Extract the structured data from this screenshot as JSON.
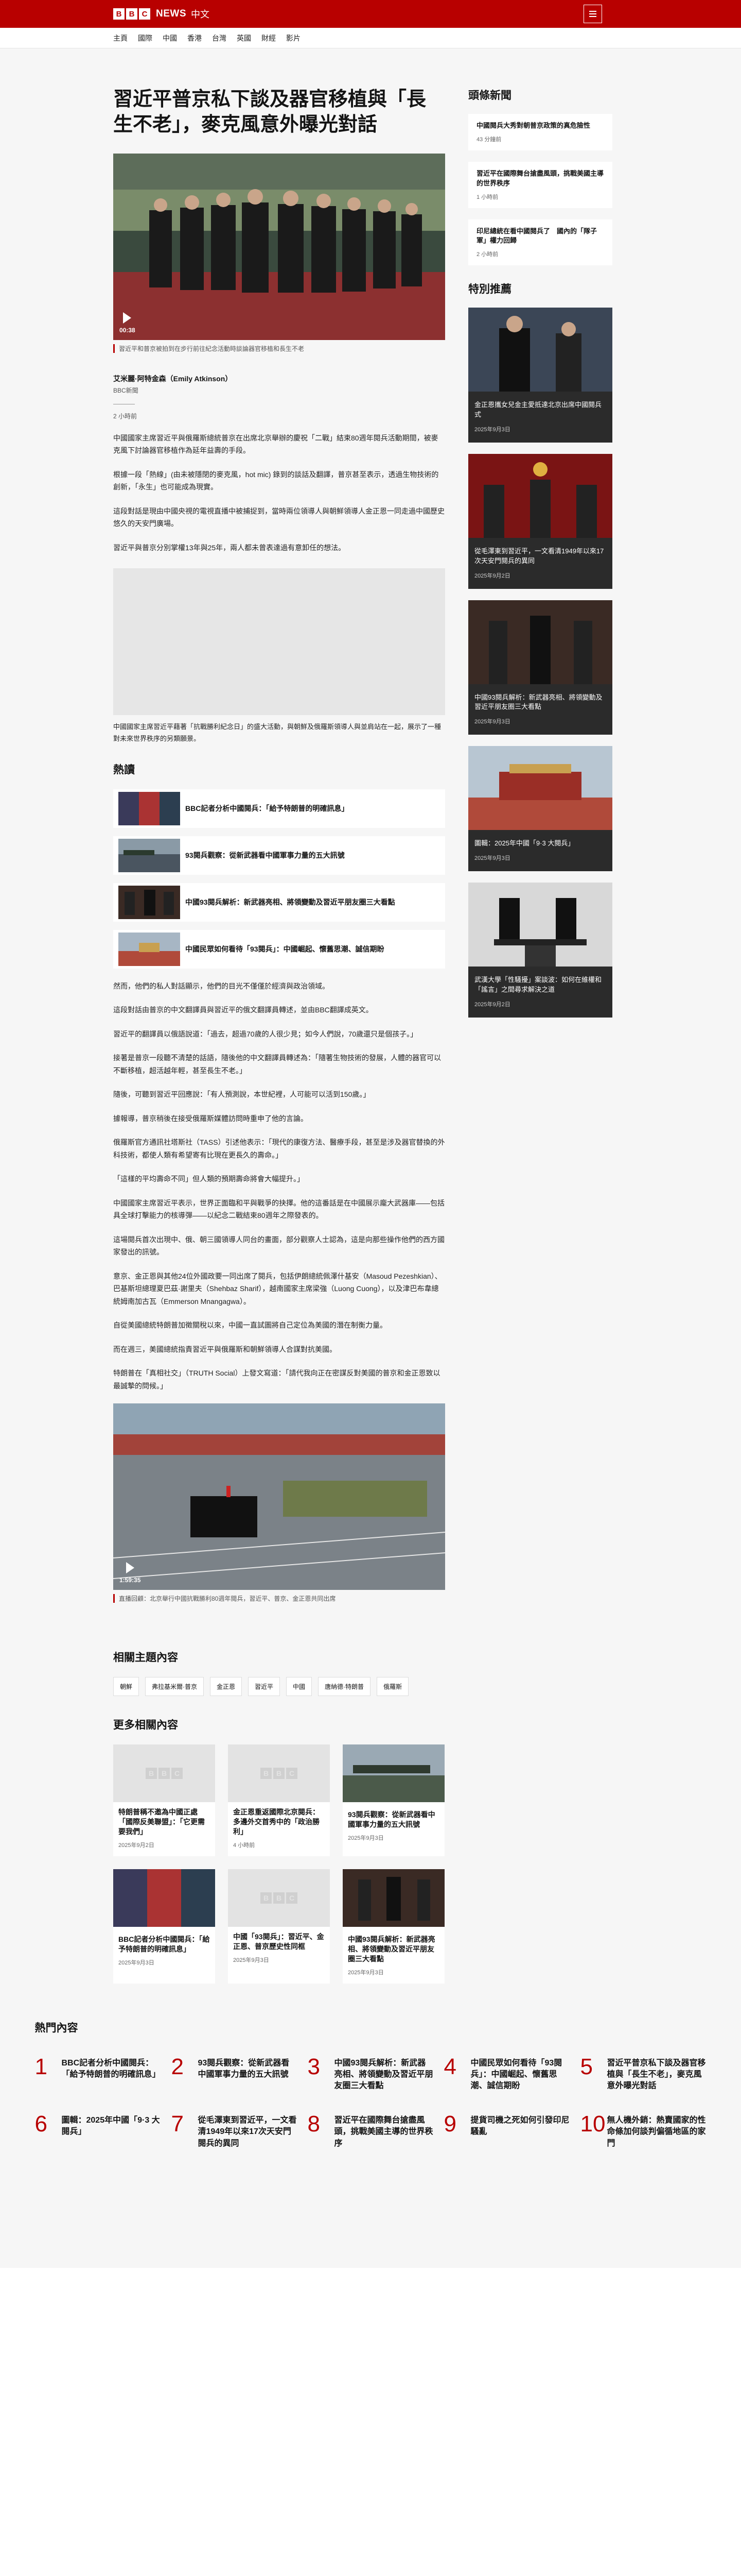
{
  "header": {
    "logo_letters": [
      "B",
      "B",
      "C"
    ],
    "logo_news": "NEWS",
    "logo_lang": "中文",
    "menu_icon": "hamburger-icon"
  },
  "nav": [
    "主頁",
    "國際",
    "中國",
    "香港",
    "台灣",
    "英國",
    "財經",
    "影片"
  ],
  "article": {
    "headline": "習近平普京私下談及器官移植與「長生不老」，麥克風意外曝光對話",
    "hero_video_duration": "00:38",
    "hero_caption": "習近平和普京被拍到在步行前往紀念活動時談論器官移植和長生不老",
    "author": "艾米麗·阿特金森（Emily Atkinson）",
    "org": "BBC新聞",
    "time": "2 小時前",
    "paras_a": [
      "中國國家主席習近平與俄羅斯總統普京在出席北京舉辦的慶祝「二戰」結束80週年閱兵活動期間，被麥克風下討論器官移植作為延年益壽的手段。",
      "根據一段「熱線」(由未被隱閉的麥克風，hot mic) 錄到的談話及翻譯，普京甚至表示，透過生物技術的創新，「永生」也可能成為現實。",
      "這段對話是現由中國央視的電視直播中被捕捉到，當時兩位領導人與朝鮮領導人金正恩一同走過中國歷史悠久的天安門廣場。",
      "習近平與普京分別掌權13年與25年，兩人都未曾表達過有意卸任的想法。"
    ],
    "image2_caption": "中國國家主席習近平藉著「抗戰勝利紀念日」的盛大活動，與朝鮮及俄羅斯領導人與並肩站在一起，展示了一種對未來世界秩序的另類願景。",
    "hot_title": "熱讀",
    "hot_items": [
      "BBC記者分析中國閱兵：「給予特朗普的明確訊息」",
      "93閱兵觀察：從新武器看中國軍事力量的五大訊號",
      "中國93閱兵解析：新武器亮相、將領變動及習近平朋友圈三大看點",
      "中國民眾如何看待「93閱兵」：中國崛起、懷舊思潮、誠信期盼"
    ],
    "paras_b": [
      "然而，他們的私人對話顯示，他們的目光不僅僅於經濟與政治領域。",
      "這段對話由普京的中文翻譯員與習近平的俄文翻譯員轉述，並由BBC翻譯成英文。",
      "習近平的翻譯員以俄語說道：「過去，超過70歲的人很少見；如今人們說，70歲還只是個孩子。」",
      "接著是普京一段聽不清楚的話語，隨後他的中文翻譯員轉述為：「隨著生物技術的發展，人體的器官可以不斷移植，超活越年輕，甚至長生不老。」",
      "隨後，可聽到習近平回應說：「有人預測說，本世紀裡，人可能可以活到150歲。」",
      "據報導，普京稍後在接受俄羅斯媒體訪問時重申了他的言論。",
      "俄羅斯官方通訊社塔斯社（TASS）引述他表示：「現代的康復方法、醫療手段，甚至是涉及器官替換的外科技術，都使人類有希望寄有比現在更長久的壽命。」",
      "「這樣的平均壽命不同」但人類的預期壽命將會大幅提升。」",
      "中國國家主席習近平表示，世界正面臨和平與戰爭的抉擇。他的這番話是在中國展示龐大武器庫——包括具全球打擊能力的核導彈——以紀念二戰結束80週年之際發表的。",
      "這場閱兵首次出現中、俄、朝三國領導人同台的畫面，部分觀察人士認為，這是向那些操作他們的西方國家發出的訊號。",
      "意京、金正恩與其他24位外國政要一同出席了閱兵，包括伊朗總統佩澤什基安（Masoud Pezeshkian）、巴基斯坦總理夏巴茲·謝里夫（Shehbaz Sharif），越南國家主席梁強（Luong Cuong），以及津巴布韋總統姆南加古瓦（Emmerson Mnangagwa）。",
      "自從美國總統特朗普加徵關稅以來，中國一直試圖將自己定位為美國的潛在制衡力量。",
      "而在週三，美國總統指責習近平與俄羅斯和朝鮮領導人合謀對抗美國。",
      "特朗普在「真相社交」（TRUTH Social）上發文寫道：「請代我向正在密謀反對美國的普京和金正恩致以最誠摯的問候。」"
    ],
    "video2_duration": "1:59:35",
    "video2_caption": "直播回顧：北京舉行中國抗戰勝利80週年閱兵，習近平、普京、金正恩共同出席",
    "tags_title": "相關主題內容",
    "tags": [
      "朝鮮",
      "弗拉基米爾·普京",
      "金正恩",
      "習近平",
      "中國",
      "唐納德·特朗普",
      "俄羅斯"
    ],
    "more_title": "更多相關內容",
    "more_cards": [
      {
        "title": "特朗普稱不邀為中國正處「國際反美聯盟」：「它更需要我們」",
        "date": "2025年9月2日"
      },
      {
        "title": "金正恩重返國際北京閱兵：多邊外交首秀中的「政治勝利」",
        "date": "4 小時前"
      },
      {
        "title": "93閱兵觀察：從新武器看中國軍事力量的五大訊號",
        "date": "2025年9月3日"
      },
      {
        "title": "BBC記者分析中國閱兵：「給予特朗普的明確訊息」",
        "date": "2025年9月3日"
      },
      {
        "title": "中國「93閱兵」：習近平、金正恩、普京歷史性同框",
        "date": "2025年9月3日"
      },
      {
        "title": "中國93閱兵解析：新武器亮相、將領變動及習近平朋友圈三大看點",
        "date": "2025年9月3日"
      }
    ]
  },
  "sidebar": {
    "news_title": "頭條新聞",
    "news": [
      {
        "title": "中國閱兵大秀對朝普京政策的真危險性",
        "time": "43 分鐘前"
      },
      {
        "title": "習近平在國際舞台搶盡風頭，挑戰美國主導的世界秩序",
        "time": "1 小時前"
      },
      {
        "title": "印尼總統在看中國閱兵了　國內的「隊子軍」權力回歸",
        "time": "2 小時前"
      }
    ],
    "feature_title": "特別推薦",
    "features": [
      {
        "title": "金正恩攜女兒金主愛抵達北京出席中國閱兵式",
        "date": "2025年9月3日"
      },
      {
        "title": "從毛澤東到習近平，一文看清1949年以來17次天安門閱兵的異同",
        "date": "2025年9月2日"
      },
      {
        "title": "中國93閱兵解析：新武器亮相、將領變動及習近平朋友圈三大看點",
        "date": "2025年9月3日"
      },
      {
        "title": "圖輯：2025年中國「9·3 大閱兵」",
        "date": "2025年9月3日"
      },
      {
        "title": "武漢大學「性騷擾」案談波：如何在維權和「謠言」之間尋求解決之道",
        "date": "2025年9月2日"
      }
    ]
  },
  "popular": {
    "title": "熱門內容",
    "items": [
      "BBC記者分析中國閱兵：「給予特朗普的明確訊息」",
      "93閱兵觀察：從新武器看中國軍事力量的五大訊號",
      "中國93閱兵解析：新武器亮相、將領變動及習近平朋友圈三大看點",
      "中國民眾如何看待「93閱兵」：中國崛起、懷舊思潮、誠信期盼",
      "習近平普京私下談及器官移植與「長生不老」，麥克風意外曝光對話",
      "圖輯：2025年中國「9·3 大閱兵」",
      "從毛澤東到習近平，一文看清1949年以來17次天安門閱兵的異同",
      "習近平在國際舞台搶盡風頭，挑戰美國主導的世界秩序",
      "提貨司機之死如何引發印尼騷亂",
      "無人機外銷：熱賣國家的性命條加何談判偏循地區的家門"
    ],
    "numbers": [
      "1",
      "2",
      "3",
      "4",
      "5",
      "6",
      "7",
      "8",
      "9",
      "10"
    ]
  },
  "colors": {
    "brand_red": "#b80000",
    "page_bg": "#f6f6f6"
  }
}
